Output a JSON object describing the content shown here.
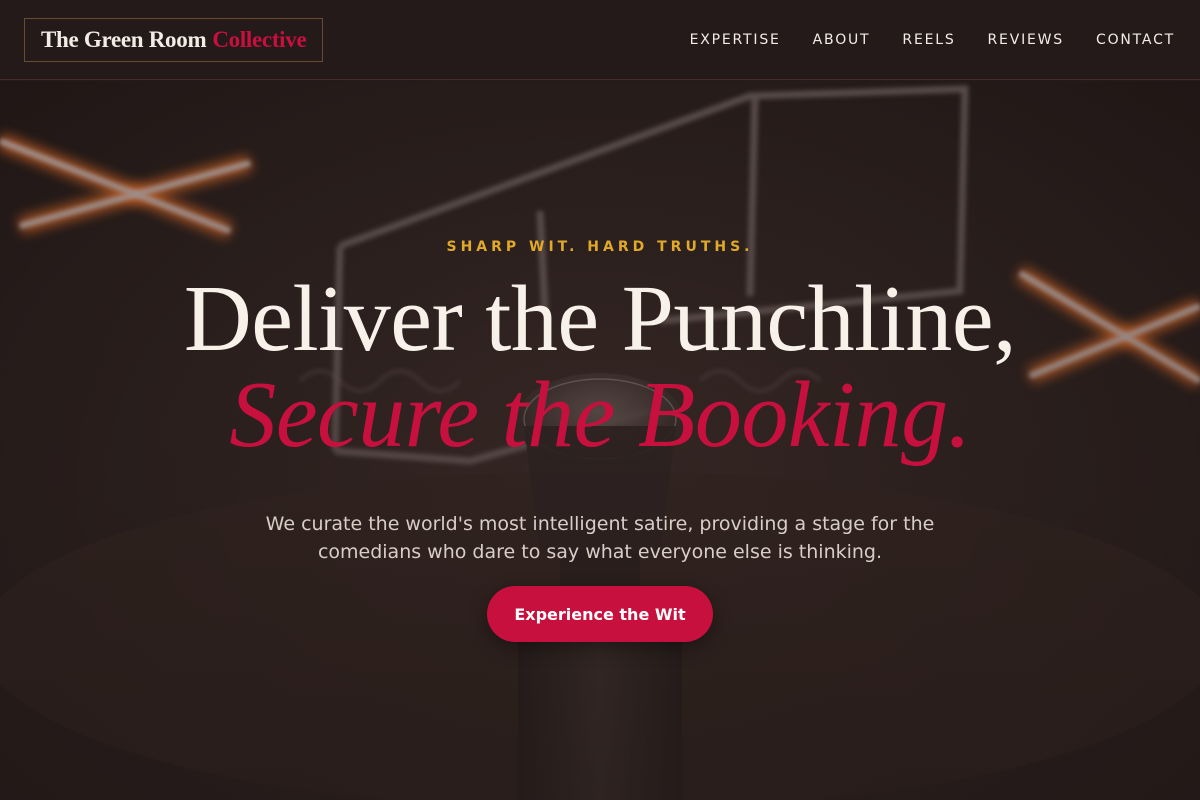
{
  "brand": {
    "name_main": "The Green Room",
    "name_accent": "Collective",
    "accent_color": "#c8103f"
  },
  "nav": {
    "items": [
      {
        "label": "EXPERTISE"
      },
      {
        "label": "ABOUT"
      },
      {
        "label": "REELS"
      },
      {
        "label": "REVIEWS"
      },
      {
        "label": "CONTACT"
      }
    ]
  },
  "hero": {
    "eyebrow": "SHARP WIT. HARD TRUTHS.",
    "headline_line1": "Deliver the Punchline,",
    "headline_line2": "Secure the Booking.",
    "subtext": "We curate the world's most intelligent satire, providing a stage for the comedians who dare to say what everyone else is thinking.",
    "cta_label": "Experience the Wit",
    "background_image": "microphone-on-stage-with-neon-lights",
    "eyebrow_color": "#e0a92a"
  }
}
